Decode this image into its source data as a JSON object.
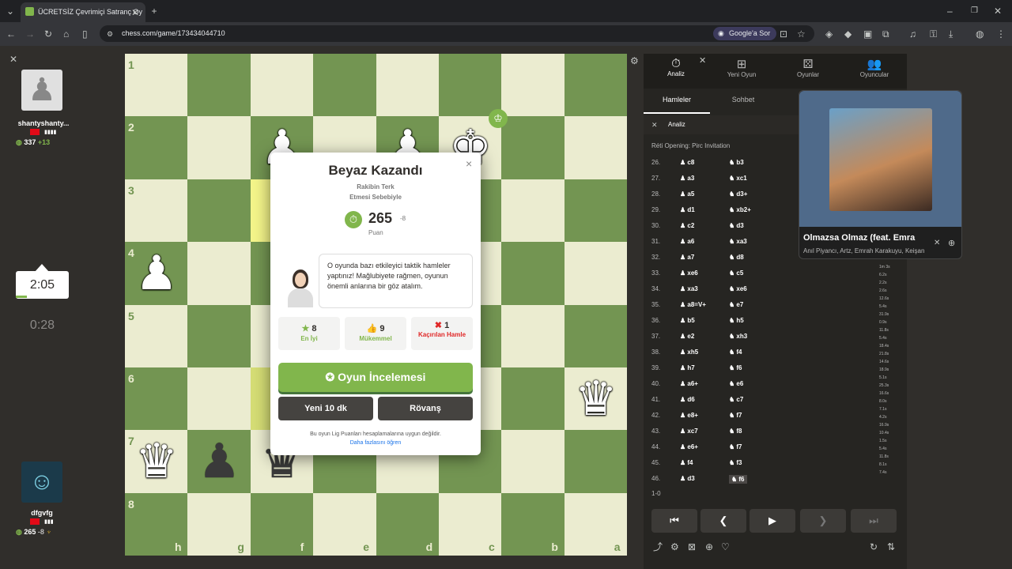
{
  "browser": {
    "tab_title": "ÜCRETSİZ Çevrimiçi Satranç Oy",
    "url": "chess.com/game/173434044710",
    "google_ask": "Google'a Sor"
  },
  "top_player": {
    "name": "shantyshanty...",
    "rating": "337",
    "delta": "+13"
  },
  "bottom_player": {
    "name": "dfgvfg",
    "rating": "265",
    "delta": "-8"
  },
  "clocks": {
    "top": "2:05",
    "bottom": "0:28"
  },
  "board": {
    "ranks": [
      "1",
      "2",
      "3",
      "4",
      "5",
      "6",
      "7",
      "8"
    ],
    "files": [
      "h",
      "g",
      "f",
      "e",
      "d",
      "c",
      "b",
      "a"
    ]
  },
  "modal": {
    "title": "Beyaz Kazandı",
    "reason_line1": "Rakibin Terk",
    "reason_line2": "Etmesi Sebebiyle",
    "rating": "265",
    "rating_delta": "-8",
    "rating_label": "Puan",
    "coach_message": "O oyunda bazı etkileyici taktik hamleler yaptınız! Mağlubiyete rağmen, oyunun önemli anlarına bir göz atalım.",
    "stats": [
      {
        "count": "8",
        "label": "En İyi"
      },
      {
        "count": "9",
        "label": "Mükemmel"
      },
      {
        "count": "1",
        "label": "Kaçırılan Hamle"
      }
    ],
    "review_button": "Oyun İncelemesi",
    "new_game_button": "Yeni 10 dk",
    "rematch_button": "Rövanş",
    "footer": "Bu oyun Lig Puanları hesaplamalarına uygun değildir.",
    "learn_more": "Daha fazlasını öğren"
  },
  "sidebar": {
    "top_tabs": [
      "Analiz",
      "Yeni Oyun",
      "Oyunlar",
      "Oyuncular"
    ],
    "sub_tabs": [
      "Hamleler",
      "Sohbet"
    ],
    "analysis_label": "Analiz",
    "opening": "Réti Opening: Pirc Invitation",
    "moves": [
      {
        "n": "26.",
        "w": "c8",
        "b": "b3"
      },
      {
        "n": "27.",
        "w": "a3",
        "b": "xc1"
      },
      {
        "n": "28.",
        "w": "a5",
        "b": "d3+"
      },
      {
        "n": "29.",
        "w": "d1",
        "b": "xb2+"
      },
      {
        "n": "30.",
        "w": "c2",
        "b": "d3"
      },
      {
        "n": "31.",
        "w": "a6",
        "b": "xa3"
      },
      {
        "n": "32.",
        "w": "a7",
        "b": "d8"
      },
      {
        "n": "33.",
        "w": "xe6",
        "b": "c5"
      },
      {
        "n": "34.",
        "w": "xa3",
        "b": "xe6"
      },
      {
        "n": "35.",
        "w": "a8=V+",
        "b": "e7"
      },
      {
        "n": "36.",
        "w": "b5",
        "b": "h5"
      },
      {
        "n": "37.",
        "w": "e2",
        "b": "xh3"
      },
      {
        "n": "38.",
        "w": "xh5",
        "b": "f4"
      },
      {
        "n": "39.",
        "w": "h7",
        "b": "f6"
      },
      {
        "n": "40.",
        "w": "a6+",
        "b": "e6"
      },
      {
        "n": "41.",
        "w": "d6",
        "b": "c7"
      },
      {
        "n": "42.",
        "w": "e8+",
        "b": "f7"
      },
      {
        "n": "43.",
        "w": "xc7",
        "b": "f8"
      },
      {
        "n": "44.",
        "w": "e6+",
        "b": "f7"
      },
      {
        "n": "45.",
        "w": "f4",
        "b": "f3"
      },
      {
        "n": "46.",
        "w": "d3",
        "b": "f6"
      }
    ],
    "times": [
      "1m 3s",
      "6.2s",
      "2.2s",
      "2.6s",
      "12.6s",
      "5.4s",
      "31.9s",
      "0.9s",
      "11.8s",
      "5.4s",
      "18.4s",
      "21.8s",
      "14.6s",
      "18.9s",
      "5.1s",
      "25.3s",
      "16.6s",
      "8.0s",
      "7.1s",
      "4.2s",
      "16.9s",
      "10.4s",
      "1.5s",
      "5.4s",
      "11.8s",
      "8.1s",
      "7.4s"
    ],
    "result": "1-0"
  },
  "media": {
    "title": "Olmazsa Olmaz (feat. Emra",
    "artists": "Anıl Piyancı, Artz, Emrah Karakuyu, Keişan"
  }
}
